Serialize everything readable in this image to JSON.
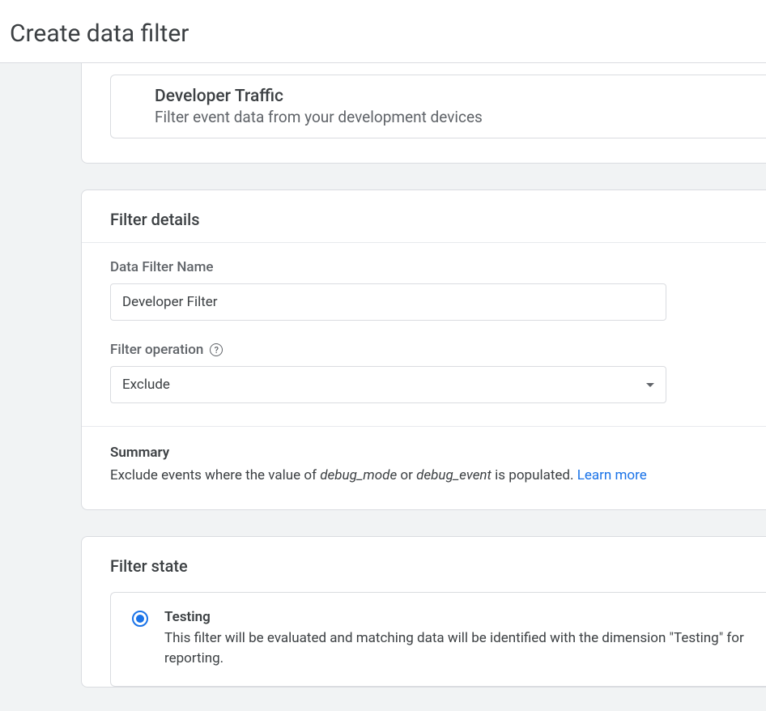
{
  "header": {
    "title": "Create data filter"
  },
  "filter_type": {
    "title": "Developer Traffic",
    "description": "Filter event data from your development devices"
  },
  "filter_details": {
    "section_title": "Filter details",
    "name_label": "Data Filter Name",
    "name_value": "Developer Filter",
    "operation_label": "Filter operation",
    "operation_value": "Exclude"
  },
  "summary": {
    "title": "Summary",
    "prefix": "Exclude events where the value of ",
    "param1": "debug_mode",
    "connector": " or ",
    "param2": "debug_event",
    "suffix": " is populated. ",
    "learn_more": "Learn more"
  },
  "filter_state": {
    "section_title": "Filter state",
    "testing": {
      "title": "Testing",
      "description": "This filter will be evaluated and matching data will be identified with the dimension \"Testing\" for reporting."
    }
  }
}
